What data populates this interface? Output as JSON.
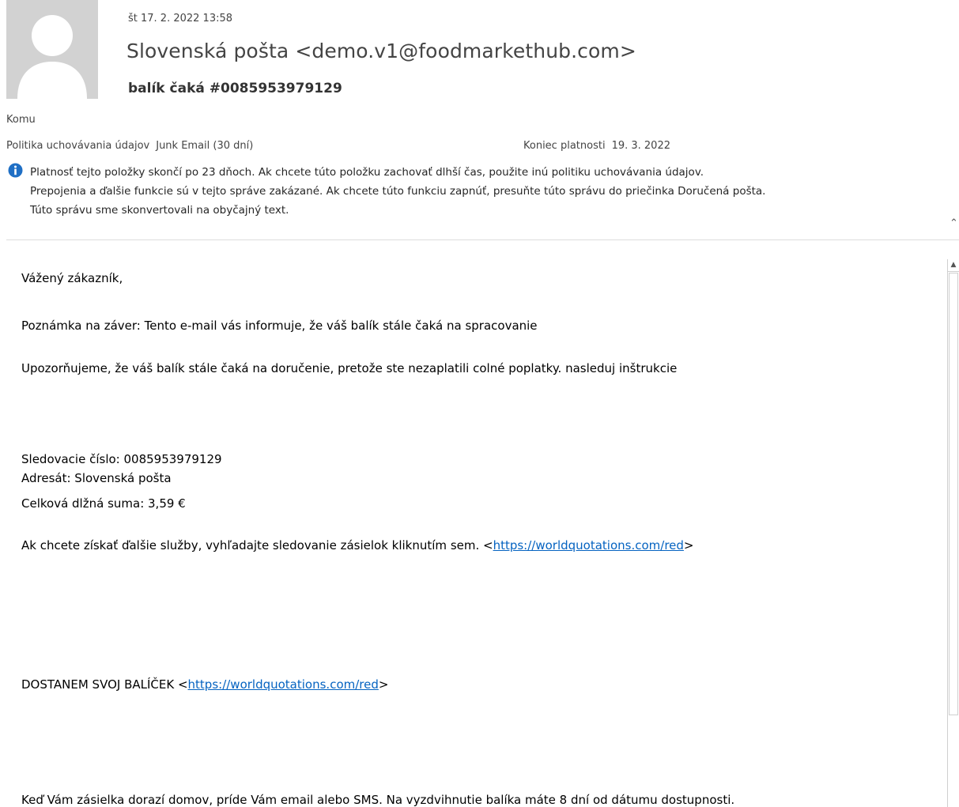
{
  "header": {
    "date": "št 17. 2. 2022 13:58",
    "sender": "Slovenská pošta <demo.v1@foodmarkethub.com>",
    "subject": "balík čaká  #0085953979129",
    "to_label": "Komu",
    "retention_label": "Politika uchovávania údajov",
    "retention_value": "Junk Email (30 dní)",
    "expires_label": "Koniec platnosti",
    "expires_value": "19. 3. 2022"
  },
  "info_bar": {
    "icon": "info-icon",
    "lines": [
      "Platnosť tejto položky skončí po 23 dňoch. Ak chcete túto položku zachovať dlhší čas, použite inú politiku uchovávania údajov.",
      "Prepojenia a ďalšie funkcie sú v tejto správe zakázané. Ak chcete túto funkciu zapnúť, presuňte túto správu do priečinka Doručená pošta.",
      "Túto správu sme skonvertovali na obyčajný text."
    ]
  },
  "message": {
    "greeting": "Vážený zákazník,",
    "note": "Poznámka na záver: Tento e-mail vás informuje, že váš balík stále čaká na spracovanie",
    "warning": "Upozorňujeme, že váš balík stále čaká na doručenie, pretože ste nezaplatili colné poplatky. nasleduj inštrukcie",
    "tracking": "Sledovacie číslo: 0085953979129",
    "addressee": "Adresát: Slovenská pošta",
    "amount": "Celková dlžná suma: 3,59 €",
    "services_text": "Ak chcete získať ďalšie služby, vyhľadajte sledovanie zásielok kliknutím sem. <",
    "services_link": "https://worldquotations.com/red",
    "services_suffix": ">",
    "get_package_text": "DOSTANEM SVOJ BALÍČEK <",
    "get_package_link": "https://worldquotations.com/red",
    "get_package_suffix": ">",
    "footer": "Keď Vám zásielka dorazí domov, príde Vám email alebo SMS. Na vyzdvihnutie balíka máte 8 dní od dátumu dostupnosti."
  },
  "colors": {
    "link": "#0563c1",
    "info_icon": "#1f6fc5"
  }
}
